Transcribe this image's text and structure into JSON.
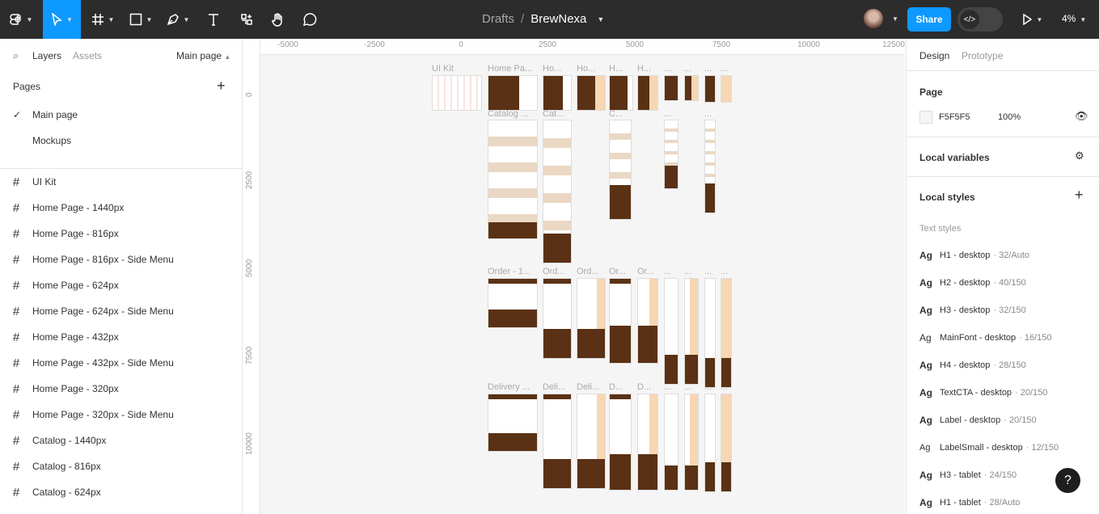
{
  "toolbar": {
    "breadcrumb_parent": "Drafts",
    "breadcrumb_sep": "/",
    "file_name": "BrewNexa",
    "share_label": "Share",
    "zoom": "4%",
    "accent": "#0d99ff"
  },
  "left_panel": {
    "tab_layers": "Layers",
    "tab_assets": "Assets",
    "current_page": "Main page",
    "pages_heading": "Pages",
    "pages": [
      "Main page",
      "Mockups"
    ],
    "layers": [
      "UI Kit",
      "Home Page - 1440px",
      "Home Page - 816px",
      "Home Page - 816px - Side Menu",
      "Home Page - 624px",
      "Home Page - 624px - Side Menu",
      "Home Page - 432px",
      "Home Page - 432px - Side Menu",
      "Home Page - 320px",
      "Home Page - 320px - Side Menu",
      "Catalog - 1440px",
      "Catalog - 816px",
      "Catalog - 624px"
    ]
  },
  "canvas": {
    "ruler_h": [
      "-5000",
      "-2500",
      "0",
      "2500",
      "5000",
      "7500",
      "10000",
      "12500"
    ],
    "ruler_v": [
      "0",
      "2500",
      "5000",
      "7500",
      "10000"
    ],
    "labels": {
      "ui_kit": "UI Kit",
      "home": [
        "Home Pa...",
        "Ho...",
        "Ho...",
        "H...",
        "H...",
        "...",
        "...",
        "...",
        "..."
      ],
      "catalog": [
        "Catalog ...",
        "Cat...",
        "C...",
        "...",
        "..."
      ],
      "order": [
        "Order - 1...",
        "Ord...",
        "Ord...",
        "Or...",
        "Or...",
        "...",
        "...",
        "...",
        "..."
      ],
      "delivery": [
        "Delivery ...",
        "Deli...",
        "Deli...",
        "D...",
        "D...",
        "...",
        "...",
        "...",
        "..."
      ]
    }
  },
  "right_panel": {
    "tab_design": "Design",
    "tab_prototype": "Prototype",
    "page_heading": "Page",
    "page_color": "F5F5F5",
    "page_opacity": "100%",
    "local_variables": "Local variables",
    "local_styles": "Local styles",
    "text_styles_heading": "Text styles",
    "text_styles": [
      {
        "name": "H1 - desktop",
        "meta": "· 32/Auto"
      },
      {
        "name": "H2 - desktop",
        "meta": "· 40/150"
      },
      {
        "name": "H3 - desktop",
        "meta": "· 32/150"
      },
      {
        "name": "MainFont - desktop",
        "meta": "· 16/150"
      },
      {
        "name": "H4 - desktop",
        "meta": "· 28/150"
      },
      {
        "name": "TextCTA - desktop",
        "meta": "· 20/150"
      },
      {
        "name": "Label - desktop",
        "meta": "· 20/150"
      },
      {
        "name": "LabelSmall - desktop",
        "meta": "· 12/150"
      },
      {
        "name": "H3 - tablet",
        "meta": "· 24/150"
      },
      {
        "name": "H1 - tablet",
        "meta": "· 28/Auto"
      }
    ],
    "ag_glyph": "Ag",
    "help": "?"
  }
}
